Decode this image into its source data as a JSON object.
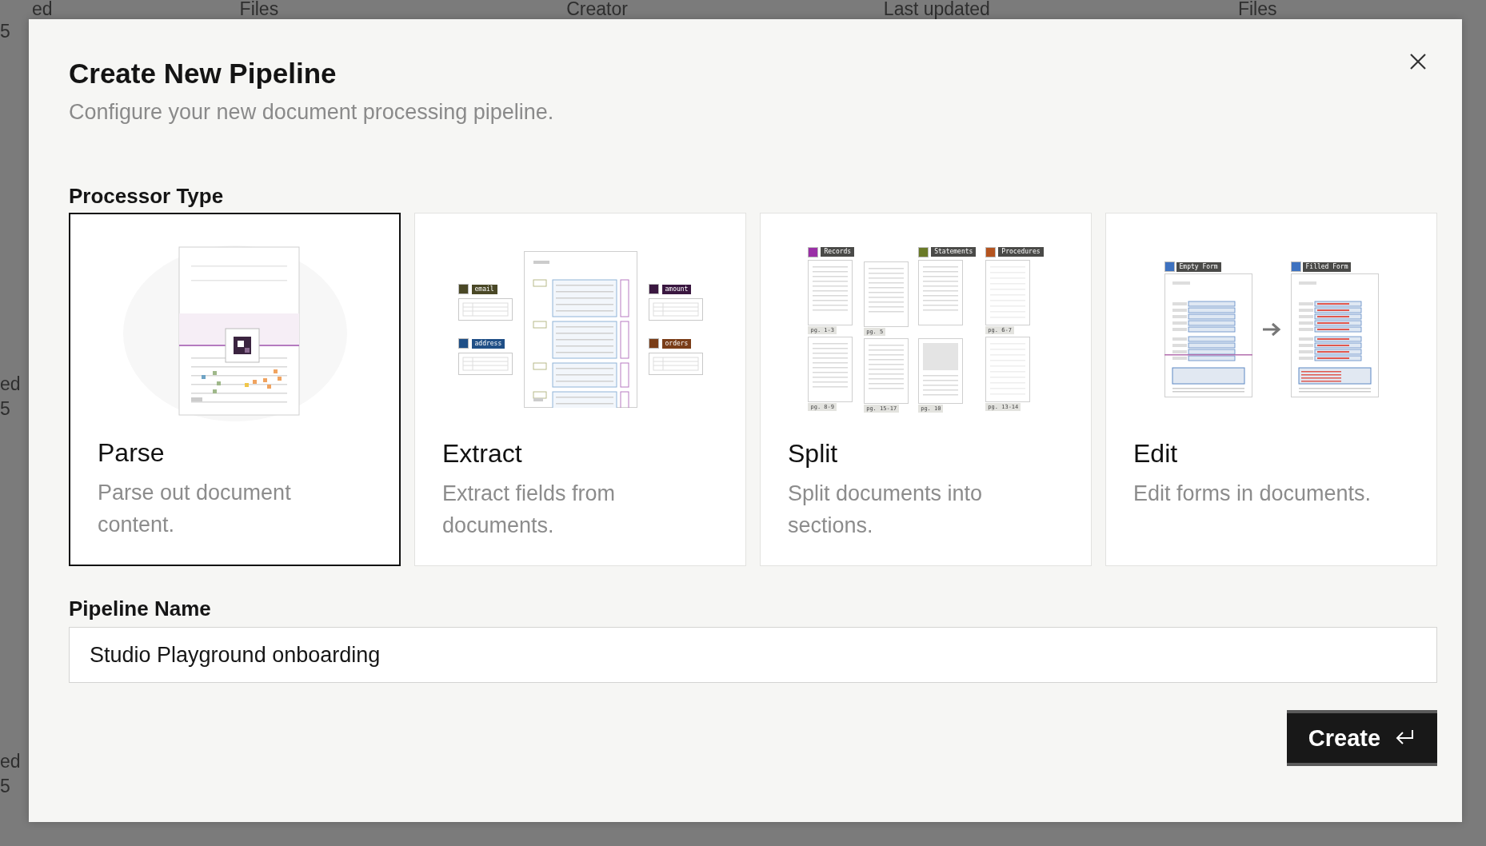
{
  "background": {
    "header": [
      "ed",
      "Files",
      "Creator",
      "Last updated",
      "Files"
    ],
    "side": [
      "5",
      "ed",
      "5",
      "ed",
      "5"
    ]
  },
  "dialog": {
    "title": "Create New Pipeline",
    "subtitle": "Configure your new document processing pipeline.",
    "processor_label": "Processor Type",
    "processors": [
      {
        "kind": "parse",
        "title": "Parse",
        "description": "Parse out document content.",
        "selected": true
      },
      {
        "kind": "extract",
        "title": "Extract",
        "description": "Extract fields from documents.",
        "selected": false,
        "fields": [
          {
            "label": "email",
            "color": "#4a4826"
          },
          {
            "label": "address",
            "color": "#1f4f86"
          },
          {
            "label": "amount",
            "color": "#3a1740"
          },
          {
            "label": "orders",
            "color": "#7a3d18"
          }
        ]
      },
      {
        "kind": "split",
        "title": "Split",
        "description": "Split documents into sections.",
        "selected": false,
        "columns": [
          {
            "tag": {
              "label": "Records",
              "color": "#9a2fa6"
            },
            "pages": [
              "pg. 1-3",
              "pg. 8-9"
            ]
          },
          {
            "pages": [
              "pg. 5",
              "pg. 15-17"
            ]
          },
          {
            "tag": {
              "label": "Statements",
              "color": "#6a7a28"
            },
            "pages": [
              "pg. 10"
            ]
          },
          {
            "tag": {
              "label": "Procedures",
              "color": "#b4541f"
            },
            "pages": [
              "pg. 6-7",
              "pg. 13-14"
            ]
          }
        ]
      },
      {
        "kind": "edit",
        "title": "Edit",
        "description": "Edit forms in documents.",
        "selected": false,
        "forms": [
          {
            "label": "Empty Form"
          },
          {
            "label": "Filled Form"
          }
        ]
      }
    ],
    "name_label": "Pipeline Name",
    "name_value": "Studio Playground onboarding",
    "create_button": "Create"
  }
}
